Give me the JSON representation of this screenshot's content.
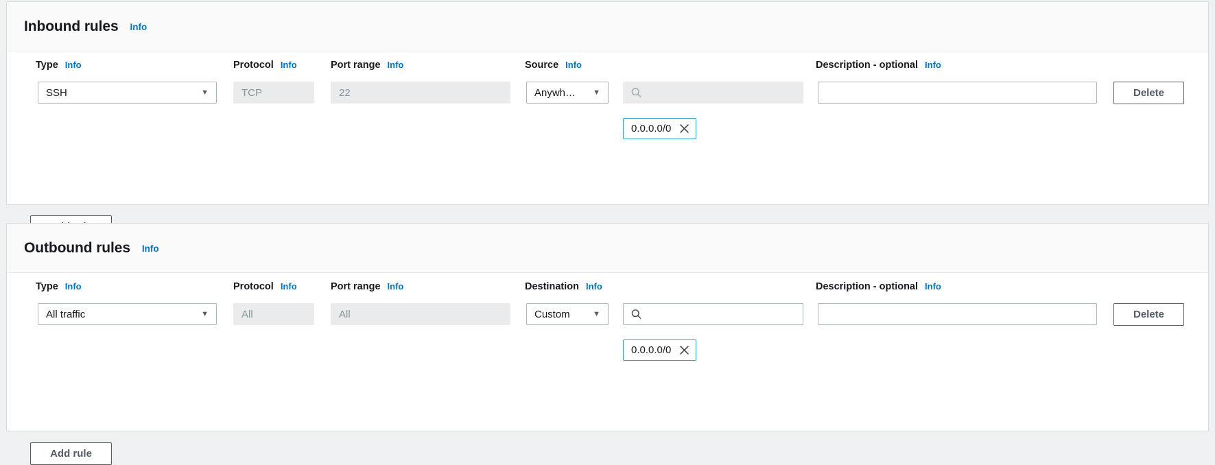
{
  "theme": {
    "accent": "#0073bb",
    "token_border": "#2ea2cc",
    "text": "#16191f",
    "muted": "#879596",
    "panel_bg": "#ffffff",
    "header_bg": "#fafafa",
    "page_bg": "#eef0f1",
    "disabled_bg": "#e9ebed",
    "border": "#aab7b8"
  },
  "common": {
    "info_label": "Info",
    "add_rule_label": "Add rule",
    "delete_label": "Delete",
    "search_icon": "search-icon",
    "remove_icon": "close-icon",
    "caret_icon": "chevron-down-icon",
    "search_placeholder": ""
  },
  "inbound": {
    "title": "Inbound rules",
    "info_label": "Info",
    "columns": [
      {
        "label": "Type",
        "info": "Info"
      },
      {
        "label": "Protocol",
        "info": "Info"
      },
      {
        "label": "Port range",
        "info": "Info"
      },
      {
        "label": "Source",
        "info": "Info"
      },
      {
        "label": "Description - optional",
        "info": "Info"
      }
    ],
    "rule": {
      "type": "SSH",
      "protocol": "TCP",
      "protocol_disabled": true,
      "port_range": "22",
      "port_disabled": true,
      "source_scope": "Anywh…",
      "source_search_value": "",
      "source_search_disabled": true,
      "source_token": "0.0.0.0/0",
      "description": "",
      "delete_label": "Delete"
    },
    "add_rule_label": "Add rule"
  },
  "outbound": {
    "title": "Outbound rules",
    "info_label": "Info",
    "columns": [
      {
        "label": "Type",
        "info": "Info"
      },
      {
        "label": "Protocol",
        "info": "Info"
      },
      {
        "label": "Port range",
        "info": "Info"
      },
      {
        "label": "Destination",
        "info": "Info"
      },
      {
        "label": "Description - optional",
        "info": "Info"
      }
    ],
    "rule": {
      "type": "All traffic",
      "protocol": "All",
      "protocol_disabled": true,
      "port_range": "All",
      "port_disabled": true,
      "destination_scope": "Custom",
      "destination_search_value": "",
      "destination_search_disabled": false,
      "destination_token": "0.0.0.0/0",
      "description": "",
      "delete_label": "Delete"
    },
    "add_rule_label": "Add rule"
  }
}
